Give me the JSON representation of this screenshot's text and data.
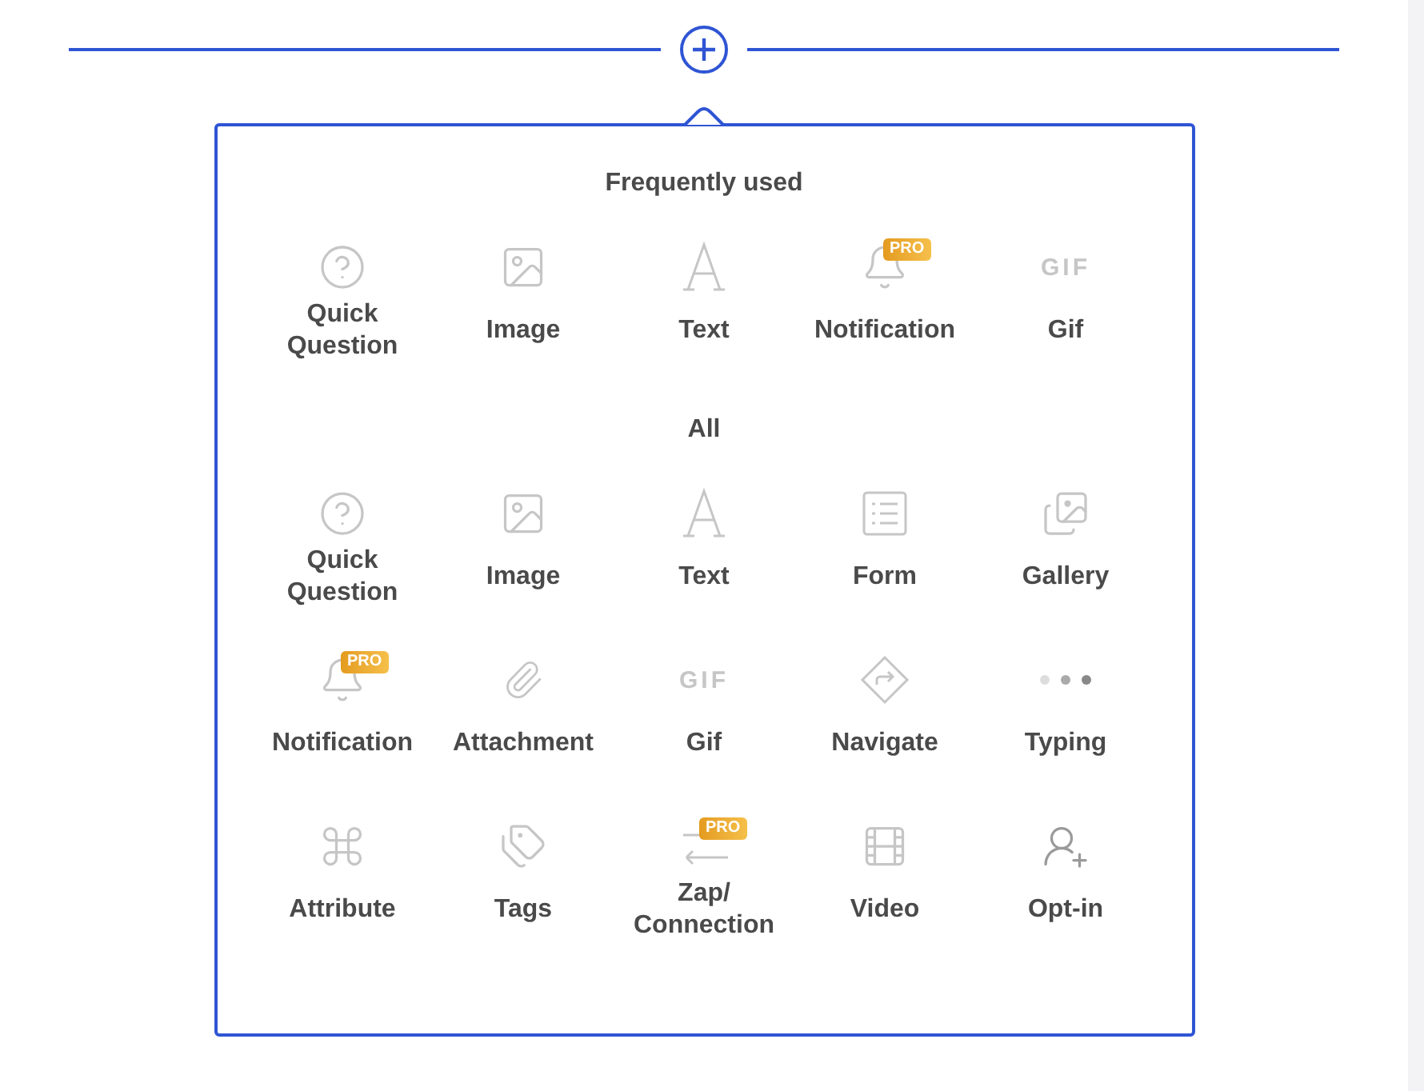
{
  "sections": [
    {
      "title": "Frequently used",
      "items": [
        {
          "kind": "question",
          "label": "Quick Question"
        },
        {
          "kind": "image",
          "label": "Image"
        },
        {
          "kind": "text",
          "label": "Text"
        },
        {
          "kind": "bell",
          "label": "Notification",
          "badge": "PRO"
        },
        {
          "kind": "gif",
          "label": "Gif",
          "icon_text": "GIF"
        }
      ]
    },
    {
      "title": "All",
      "items": [
        {
          "kind": "question",
          "label": "Quick Question"
        },
        {
          "kind": "image",
          "label": "Image"
        },
        {
          "kind": "text",
          "label": "Text"
        },
        {
          "kind": "form",
          "label": "Form"
        },
        {
          "kind": "gallery",
          "label": "Gallery"
        },
        {
          "kind": "bell",
          "label": "Notification",
          "badge": "PRO"
        },
        {
          "kind": "paperclip",
          "label": "Attachment"
        },
        {
          "kind": "gif",
          "label": "Gif",
          "icon_text": "GIF"
        },
        {
          "kind": "navigate",
          "label": "Navigate"
        },
        {
          "kind": "dots",
          "label": "Typing"
        },
        {
          "kind": "command",
          "label": "Attribute"
        },
        {
          "kind": "tags",
          "label": "Tags"
        },
        {
          "kind": "zap",
          "label": "Zap/ Connection",
          "badge": "PRO"
        },
        {
          "kind": "film",
          "label": "Video"
        },
        {
          "kind": "user",
          "label": "Opt-in"
        }
      ]
    }
  ]
}
